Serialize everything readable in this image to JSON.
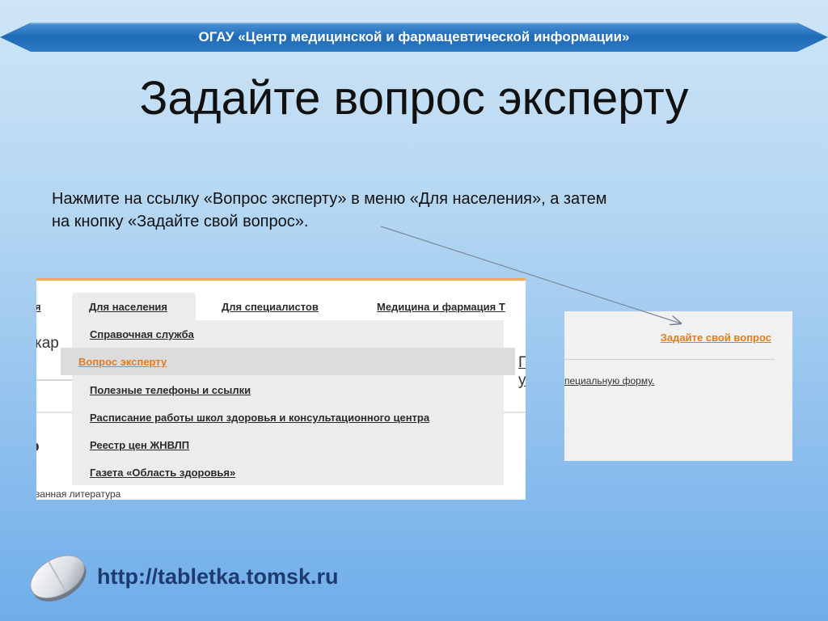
{
  "banner": {
    "text": "ОГАУ «Центр медицинской и фармацевтической информации»",
    "color": "#2e7ac4"
  },
  "title": "Задайте вопрос эксперту",
  "instruction": {
    "line1": "Нажмите на ссылку «Вопрос эксперту» в меню «Для населения», а затем",
    "line2": "на кнопку «Задайте свой вопрос»."
  },
  "screenshot_menu": {
    "nav": [
      {
        "label": "я"
      },
      {
        "label": "Для населения",
        "active": true
      },
      {
        "label": "Для специалистов"
      },
      {
        "label": "Медицина и фармация Т"
      }
    ],
    "dropdown": [
      {
        "label": "Справочная служба"
      },
      {
        "label": "Вопрос эксперту",
        "active": true
      },
      {
        "label": "Полезные телефоны и ссылки"
      },
      {
        "label": "Расписание работы школ здоровья и консультационного центра"
      },
      {
        "label": "Реестр цен ЖНВЛП"
      },
      {
        "label": "Газета «Область здоровья»"
      }
    ],
    "fragments": {
      "left_word": "кар",
      "left_digit": "о",
      "right_top": "П",
      "right_bottom": "у",
      "bottom_link": "ванная литература"
    },
    "accent": "#e07b1f"
  },
  "screenshot_button": {
    "ask_label": "Задайте свой вопрос",
    "form_text": "пециальную форму."
  },
  "footer": {
    "url": "http://tabletka.tomsk.ru",
    "logo": "pill-icon"
  }
}
